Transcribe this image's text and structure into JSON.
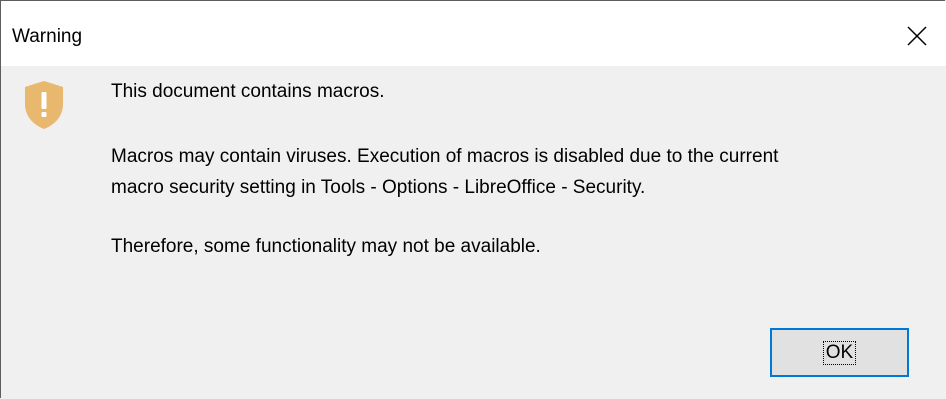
{
  "window": {
    "title": "Warning",
    "close_icon": "close-icon"
  },
  "message": {
    "icon": "shield-warning-icon",
    "line1": "This document contains macros.",
    "line2a": "Macros may contain viruses. Execution of macros is disabled due to the current",
    "line2b": "macro security setting in Tools - Options - LibreOffice - Security.",
    "line3": "Therefore, some functionality may not be available."
  },
  "buttons": {
    "ok_label": "OK"
  },
  "colors": {
    "accent": "#0078d7",
    "warning_shield": "#e8b86e"
  }
}
